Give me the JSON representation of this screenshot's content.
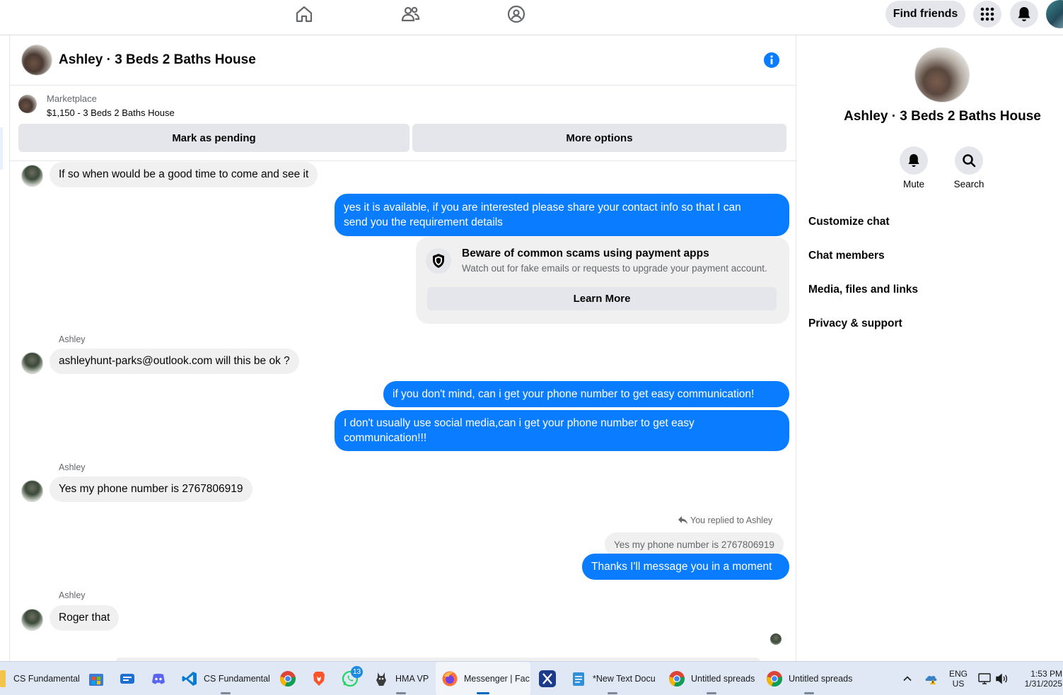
{
  "topnav": {
    "find_friends": "Find friends"
  },
  "chat": {
    "header_title": "Ashley · 3 Beds 2 Baths House",
    "marketplace": {
      "label": "Marketplace",
      "listing": "$1,150 - 3 Beds 2 Baths House",
      "mark_pending": "Mark as pending",
      "more_options": "More options"
    },
    "messages": {
      "m1": "If so when would be a good time to come and see it",
      "m2_line1": "yes it is available, if you are interested please share your contact info so that I can",
      "m2_line2": "send you the requirement details",
      "scam_title": "Beware of common scams using payment apps",
      "scam_desc": "Watch out for fake emails or requests to upgrade your payment account.",
      "learn_more": "Learn More",
      "sender1": "Ashley",
      "m3": "ashleyhunt-parks@outlook.com will this be ok ?",
      "m4": "if you don't mind, can i get your phone number to get easy communication!",
      "m5_line1": "I don't usually use social media,can i get your phone number to get easy",
      "m5_line2": "communication!!!",
      "sender2": "Ashley",
      "m6": "Yes my phone number is 2767806919",
      "replied_note": "You replied to Ashley",
      "quoted": "Yes my phone number is 2767806919",
      "m7": "Thanks I'll message you in a moment",
      "sender3": "Ashley",
      "m8": "Roger that"
    }
  },
  "right_panel": {
    "title": "Ashley · 3 Beds 2 Baths House",
    "mute": "Mute",
    "search": "Search",
    "menu": [
      "Customize chat",
      "Chat members",
      "Media, files and links",
      "Privacy & support"
    ]
  },
  "taskbar": {
    "items": [
      "CS Fundamental",
      "CS Fundamental",
      "HMA VP",
      "Messenger | Fac",
      "*New Text Docu",
      "Untitled spreads",
      "Untitled spreads"
    ],
    "whatsapp_badge": "13",
    "lang1": "ENG",
    "lang2": "US",
    "time": "1:53 PM",
    "date": "1/31/2025"
  },
  "colors": {
    "messenger_blue": "#0a7cff",
    "bubble_gray": "#f0f0f0",
    "button_gray": "#e4e6eb"
  }
}
